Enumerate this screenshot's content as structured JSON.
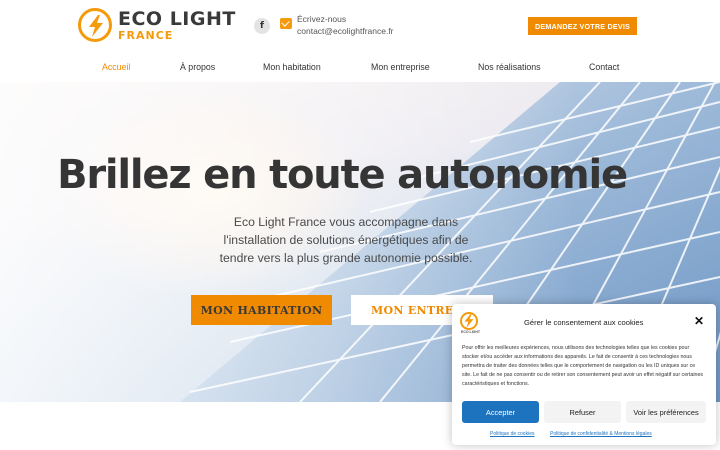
{
  "brand": {
    "name": "ECO LIGHT",
    "sub": "FRANCE",
    "accent": "#f08a00",
    "text_color": "#353535"
  },
  "header": {
    "facebook_glyph": "f",
    "contact_label": "Écrivez-nous",
    "contact_email": "contact@ecolightfrance.fr",
    "quote_button": "DEMANDEZ VOTRE DEVIS"
  },
  "nav": {
    "items": [
      {
        "label": "Accueil",
        "active": true
      },
      {
        "label": "À propos",
        "active": false
      },
      {
        "label": "Mon habitation",
        "active": false
      },
      {
        "label": "Mon entreprise",
        "active": false
      },
      {
        "label": "Nos réalisations",
        "active": false
      },
      {
        "label": "Contact",
        "active": false
      }
    ]
  },
  "hero": {
    "title": "Brillez en toute autonomie",
    "subtitle": "Eco Light France vous accompagne dans l'installation de solutions énergétiques afin de tendre vers la plus grande autonomie possible.",
    "btn_habitation": "MON HABITATION",
    "btn_entreprise": "MON ENTREPRISE"
  },
  "cookie": {
    "logo_text": "ECO LIGHT",
    "title": "Gérer le consentement aux cookies",
    "close_glyph": "✕",
    "body": "Pour offrir les meilleures expériences, nous utilisons des technologies telles que les cookies pour stocker et/ou accéder aux informations des appareils. Le fait de consentir à ces technologies nous permettra de traiter des données telles que le comportement de navigation ou les ID uniques sur ce site. Le fait de ne pas consentir ou de retirer son consentement peut avoir un effet négatif sur certaines caractéristiques et fonctions.",
    "accept": "Accepter",
    "refuse": "Refuser",
    "preferences": "Voir les préférences",
    "link_cookies": "Politique de cookies",
    "link_privacy": "Politique de confidentialité & Mentions légales",
    "accept_color": "#1e73be"
  }
}
